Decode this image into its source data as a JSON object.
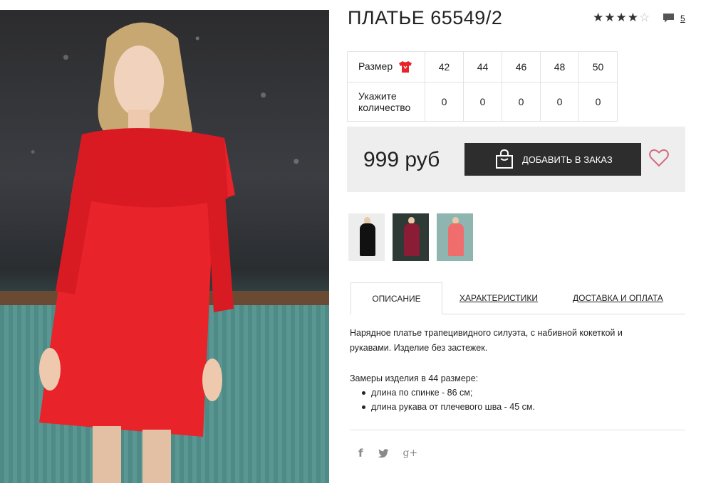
{
  "product": {
    "title": "ПЛАТЬЕ 65549/2",
    "rating_stars": 4,
    "rating_max": 5,
    "comments_count": "5"
  },
  "sizes": {
    "size_label": "Размер",
    "qty_label": "Укажите количество",
    "columns": [
      "42",
      "44",
      "46",
      "48",
      "50"
    ],
    "quantities": [
      "0",
      "0",
      "0",
      "0",
      "0"
    ]
  },
  "purchase": {
    "price": "999 руб",
    "add_button": "ДОБАВИТЬ В ЗАКАЗ"
  },
  "tabs": {
    "description": "ОПИСАНИЕ",
    "characteristics": "ХАРАКТЕРИСТИКИ",
    "delivery": "ДОСТАВКА И ОПЛАТА"
  },
  "description": {
    "text": "Нарядное платье трапецивидного силуэта, с набивной кокеткой и рукавами. Изделие без застежек.",
    "measures_title": "Замеры изделия в 44 размере:",
    "measures": [
      "длина по спинке - 86 см;",
      "длина рукава от плечевого шва - 45 см."
    ]
  },
  "social": {
    "facebook": "f",
    "googleplus": "g+"
  },
  "icons": {
    "star": "star-icon",
    "comment": "comment-icon",
    "size_chart": "shirt-icon",
    "bag": "shopping-bag-icon",
    "wishlist": "heart-icon",
    "twitter": "twitter-icon"
  },
  "colors": {
    "accent_red": "#e8232a",
    "button_dark": "#2d2d2d",
    "heart": "#d16a7e"
  }
}
